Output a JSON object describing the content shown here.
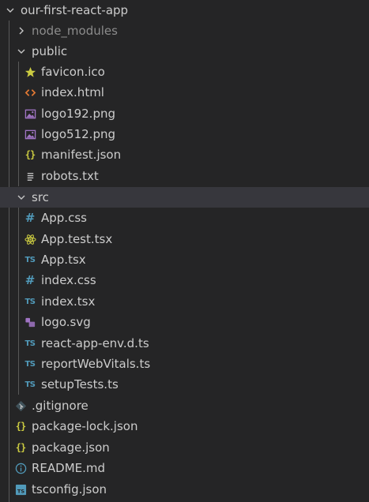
{
  "root": {
    "label": "our-first-react-app",
    "expanded": true
  },
  "items": [
    {
      "label": "node_modules",
      "type": "folder",
      "expanded": false,
      "dim": true
    },
    {
      "label": "public",
      "type": "folder",
      "expanded": true
    },
    {
      "label": "favicon.ico",
      "type": "file",
      "icon": "star-icon",
      "color": "#cbcb41"
    },
    {
      "label": "index.html",
      "type": "file",
      "icon": "html-icon",
      "color": "#e37933"
    },
    {
      "label": "logo192.png",
      "type": "file",
      "icon": "image-icon",
      "color": "#a074c4"
    },
    {
      "label": "logo512.png",
      "type": "file",
      "icon": "image-icon",
      "color": "#a074c4"
    },
    {
      "label": "manifest.json",
      "type": "file",
      "icon": "json-icon",
      "color": "#cbcb41"
    },
    {
      "label": "robots.txt",
      "type": "file",
      "icon": "text-lines-icon",
      "color": "#cccccc"
    },
    {
      "label": "src",
      "type": "folder",
      "expanded": true,
      "active": true
    },
    {
      "label": "App.css",
      "type": "file",
      "icon": "css-icon",
      "color": "#519aba"
    },
    {
      "label": "App.test.tsx",
      "type": "file",
      "icon": "react-test-icon",
      "color": "#cbcb41"
    },
    {
      "label": "App.tsx",
      "type": "file",
      "icon": "ts-icon",
      "color": "#519aba"
    },
    {
      "label": "index.css",
      "type": "file",
      "icon": "css-icon",
      "color": "#519aba"
    },
    {
      "label": "index.tsx",
      "type": "file",
      "icon": "ts-icon",
      "color": "#519aba"
    },
    {
      "label": "logo.svg",
      "type": "file",
      "icon": "svg-icon",
      "color": "#a074c4"
    },
    {
      "label": "react-app-env.d.ts",
      "type": "file",
      "icon": "ts-icon",
      "color": "#519aba"
    },
    {
      "label": "reportWebVitals.ts",
      "type": "file",
      "icon": "ts-icon",
      "color": "#519aba"
    },
    {
      "label": "setupTests.ts",
      "type": "file",
      "icon": "ts-icon",
      "color": "#519aba"
    },
    {
      "label": ".gitignore",
      "type": "file",
      "icon": "git-icon",
      "color": "#41535b"
    },
    {
      "label": "package-lock.json",
      "type": "file",
      "icon": "json-icon",
      "color": "#cbcb41"
    },
    {
      "label": "package.json",
      "type": "file",
      "icon": "json-icon",
      "color": "#cbcb41"
    },
    {
      "label": "README.md",
      "type": "file",
      "icon": "info-icon",
      "color": "#519aba"
    },
    {
      "label": "tsconfig.json",
      "type": "file",
      "icon": "tsconfig-icon",
      "color": "#519aba"
    }
  ]
}
